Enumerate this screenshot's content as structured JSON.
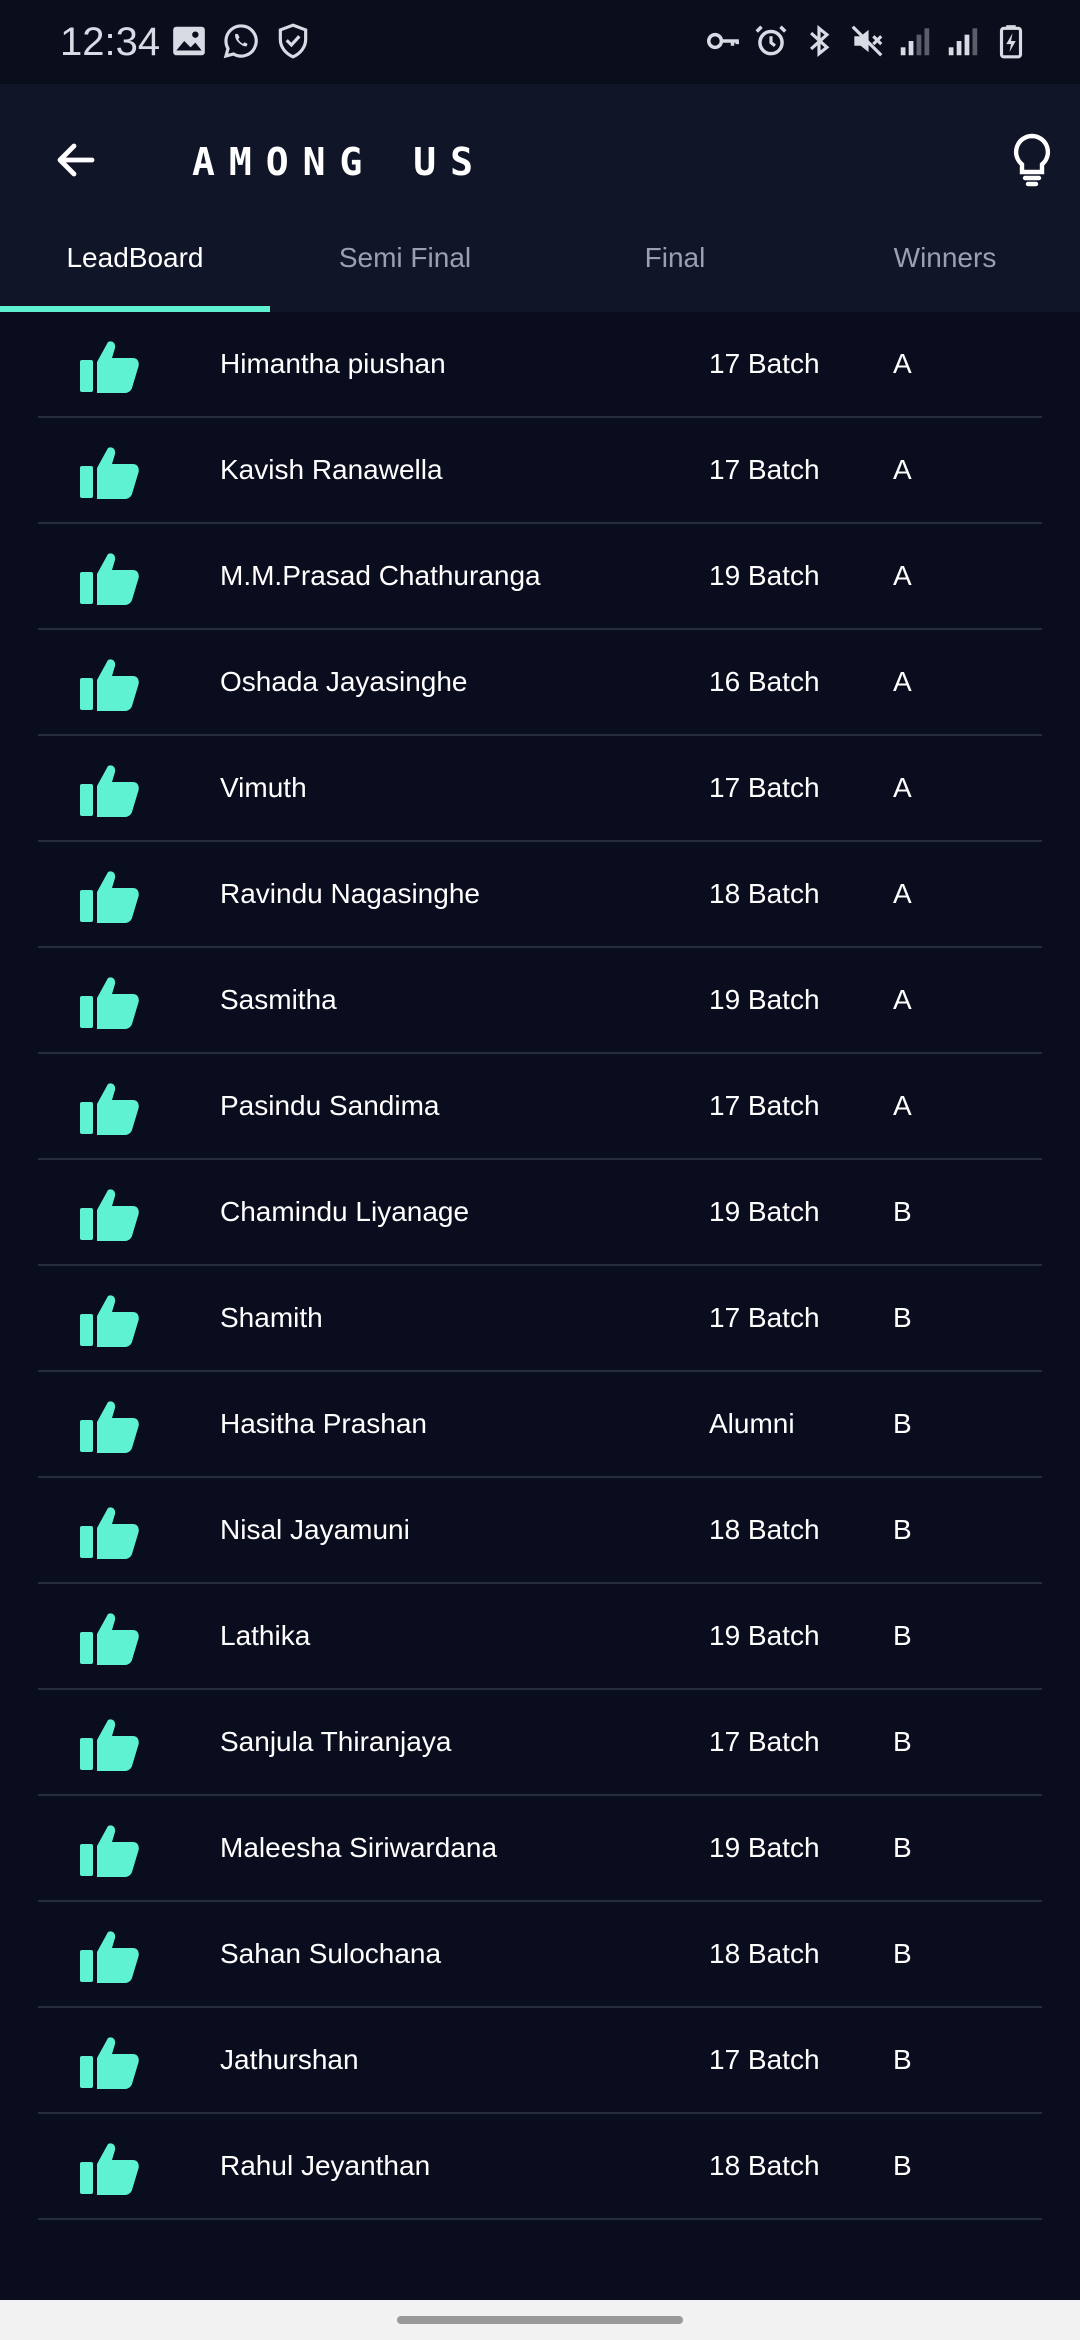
{
  "status_bar": {
    "time": "12:34",
    "left_icons": [
      "image-icon",
      "whatsapp-icon",
      "shield-icon"
    ],
    "right_icons": [
      "key-icon",
      "alarm-icon",
      "bluetooth-icon",
      "mute-icon",
      "signal-icon",
      "signal-icon",
      "battery-charging-icon"
    ]
  },
  "header": {
    "title": "AMONG US",
    "back_icon": "arrow-left-icon",
    "hint_icon": "lightbulb-icon"
  },
  "tabs": [
    {
      "label": "LeadBoard",
      "active": true
    },
    {
      "label": "Semi Final",
      "active": false
    },
    {
      "label": "Final",
      "active": false
    },
    {
      "label": "Winners",
      "active": false
    }
  ],
  "colors": {
    "accent": "#5ff2d2",
    "background": "#0a0d1e",
    "header": "#101528"
  },
  "leaderboard": [
    {
      "name": "Himantha piushan",
      "batch": "17 Batch",
      "group": "A"
    },
    {
      "name": "Kavish Ranawella",
      "batch": "17 Batch",
      "group": "A"
    },
    {
      "name": "M.M.Prasad Chathuranga",
      "batch": "19 Batch",
      "group": "A"
    },
    {
      "name": "Oshada Jayasinghe",
      "batch": "16 Batch",
      "group": "A"
    },
    {
      "name": "Vimuth",
      "batch": "17 Batch",
      "group": "A"
    },
    {
      "name": "Ravindu Nagasinghe",
      "batch": "18 Batch",
      "group": "A"
    },
    {
      "name": "Sasmitha",
      "batch": "19 Batch",
      "group": "A"
    },
    {
      "name": "Pasindu Sandima",
      "batch": "17 Batch",
      "group": "A"
    },
    {
      "name": "Chamindu Liyanage",
      "batch": "19 Batch",
      "group": "B"
    },
    {
      "name": "Shamith",
      "batch": "17 Batch",
      "group": "B"
    },
    {
      "name": "Hasitha Prashan",
      "batch": "Alumni",
      "group": "B"
    },
    {
      "name": "Nisal Jayamuni",
      "batch": "18 Batch",
      "group": "B"
    },
    {
      "name": "Lathika",
      "batch": "19 Batch",
      "group": "B"
    },
    {
      "name": "Sanjula Thiranjaya",
      "batch": "17 Batch",
      "group": "B"
    },
    {
      "name": "Maleesha Siriwardana",
      "batch": "19 Batch",
      "group": "B"
    },
    {
      "name": "Sahan Sulochana",
      "batch": "18 Batch",
      "group": "B"
    },
    {
      "name": "Jathurshan",
      "batch": "17 Batch",
      "group": "B"
    },
    {
      "name": "Rahul Jeyanthan",
      "batch": "18 Batch",
      "group": "B"
    }
  ],
  "row_icon": "thumbs-up-icon"
}
